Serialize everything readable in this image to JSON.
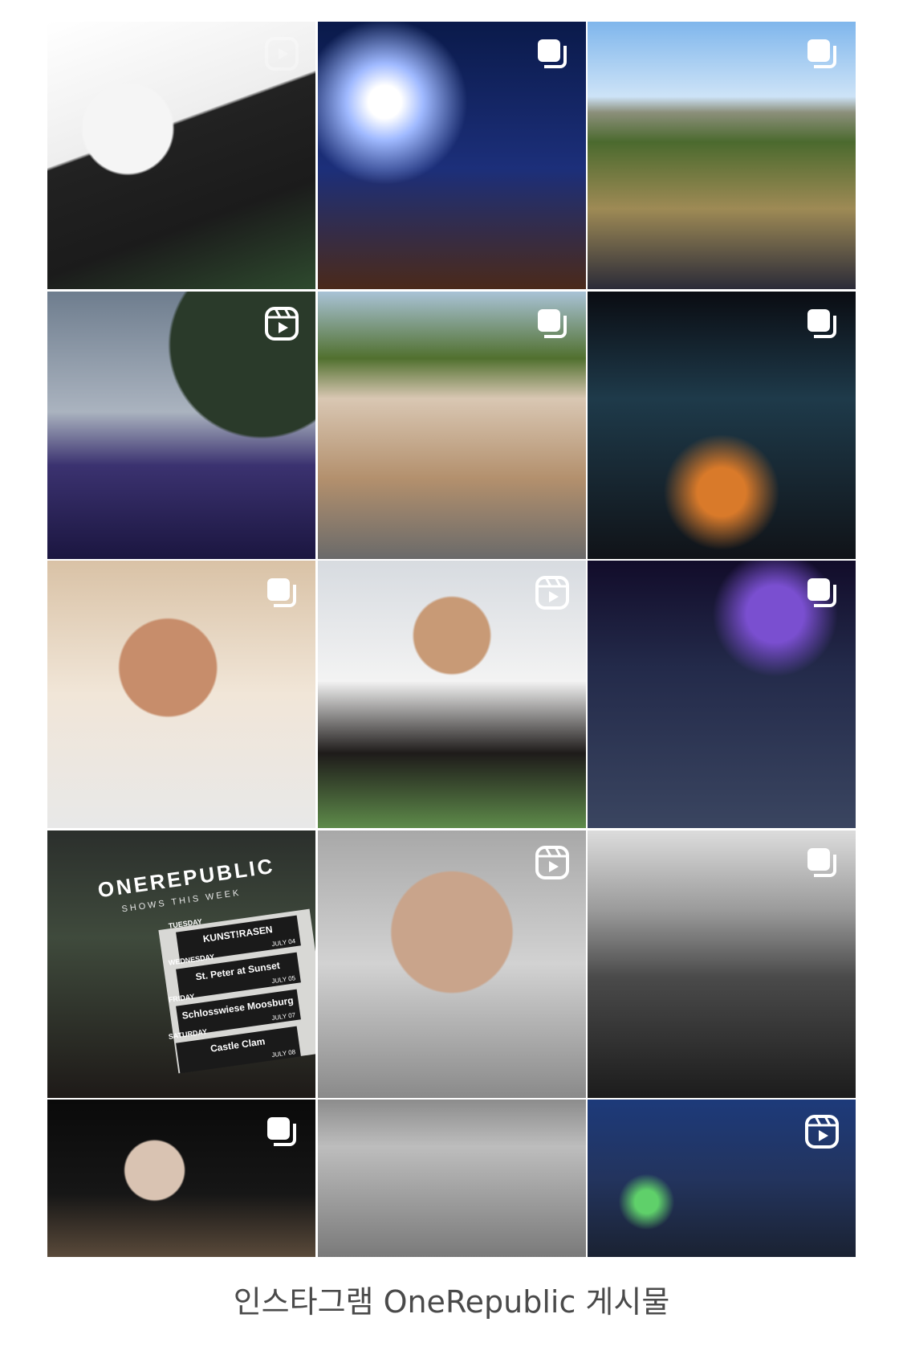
{
  "posts": [
    {
      "type": "reel",
      "icon": "reel-icon"
    },
    {
      "type": "carousel",
      "icon": "carousel-icon"
    },
    {
      "type": "carousel",
      "icon": "carousel-icon"
    },
    {
      "type": "reel",
      "icon": "reel-icon"
    },
    {
      "type": "carousel",
      "icon": "carousel-icon"
    },
    {
      "type": "carousel",
      "icon": "carousel-icon"
    },
    {
      "type": "carousel",
      "icon": "carousel-icon"
    },
    {
      "type": "reel",
      "icon": "reel-icon"
    },
    {
      "type": "carousel",
      "icon": "carousel-icon"
    },
    {
      "type": "image",
      "icon": ""
    },
    {
      "type": "reel",
      "icon": "reel-icon"
    },
    {
      "type": "carousel",
      "icon": "carousel-icon"
    },
    {
      "type": "carousel",
      "icon": "carousel-icon"
    },
    {
      "type": "image",
      "icon": ""
    },
    {
      "type": "reel",
      "icon": "reel-icon"
    }
  ],
  "poster": {
    "title": "ONEREPUBLIC",
    "subtitle": "SHOWS THIS WEEK",
    "shows": [
      {
        "day": "TUESDAY",
        "venue": "KUNST!RASEN",
        "date": "JULY 04"
      },
      {
        "day": "WEDNESDAY",
        "venue": "St. Peter at Sunset",
        "date": "JULY 05"
      },
      {
        "day": "FRIDAY",
        "venue": "Schlosswiese Moosburg",
        "date": "JULY 07"
      },
      {
        "day": "SATURDAY",
        "venue": "Castle Clam",
        "date": "JULY 08"
      }
    ]
  },
  "caption": "인스타그램 OneRepublic 게시물"
}
